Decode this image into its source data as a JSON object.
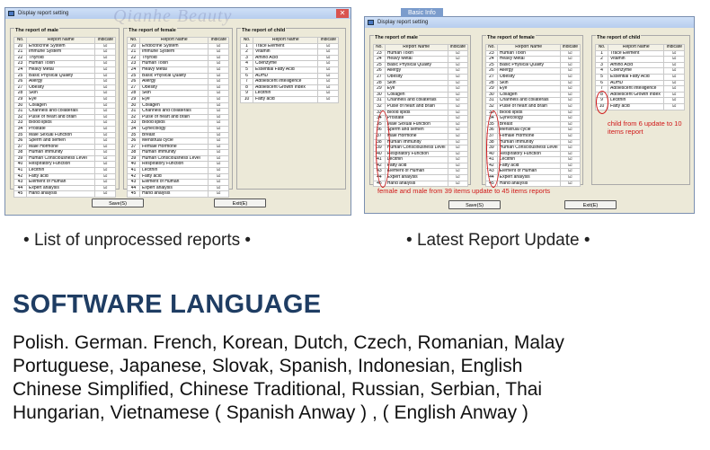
{
  "left_window": {
    "title": "Display report setting",
    "watermark": "Qianhe Beauty",
    "male": {
      "title": "The report of male",
      "head": [
        "No.",
        "Report Name",
        "Indicate"
      ],
      "rows": [
        [
          "20",
          "Endocrine System"
        ],
        [
          "21",
          "Immune System"
        ],
        [
          "22",
          "Thyroid"
        ],
        [
          "23",
          "Human Toxin"
        ],
        [
          "24",
          "Heavy Metal"
        ],
        [
          "25",
          "Basic Physical Quality"
        ],
        [
          "26",
          "Allergy"
        ],
        [
          "27",
          "Obesity"
        ],
        [
          "28",
          "Skin"
        ],
        [
          "29",
          "Eye"
        ],
        [
          "30",
          "Collagen"
        ],
        [
          "31",
          "Channels and collaterals"
        ],
        [
          "32",
          "Pulse of heart and brain"
        ],
        [
          "33",
          "Blood lipids"
        ],
        [
          "34",
          "Prostate"
        ],
        [
          "35",
          "Male Sexual Function"
        ],
        [
          "36",
          "Sperm and semen"
        ],
        [
          "37",
          "Male Hormone"
        ],
        [
          "38",
          "Human Immunity"
        ],
        [
          "39",
          "Human Consciousness Level"
        ],
        [
          "40",
          "Respiratory Function"
        ],
        [
          "41",
          "Lecithin"
        ],
        [
          "42",
          "Fatty acid"
        ],
        [
          "43",
          "Element of Human"
        ],
        [
          "44",
          "Expert analysis"
        ],
        [
          "45",
          "Hand analysis"
        ]
      ]
    },
    "female": {
      "title": "The report of female",
      "head": [
        "No.",
        "Report Name",
        "Indicate"
      ],
      "rows": [
        [
          "20",
          "Endocrine System"
        ],
        [
          "21",
          "Immune System"
        ],
        [
          "22",
          "Thyroid"
        ],
        [
          "23",
          "Human Toxin"
        ],
        [
          "24",
          "Heavy Metal"
        ],
        [
          "25",
          "Basic Physical Quality"
        ],
        [
          "26",
          "Allergy"
        ],
        [
          "27",
          "Obesity"
        ],
        [
          "28",
          "Skin"
        ],
        [
          "29",
          "Eye"
        ],
        [
          "30",
          "Collagen"
        ],
        [
          "31",
          "Channels and collaterals"
        ],
        [
          "32",
          "Pulse of heart and brain"
        ],
        [
          "33",
          "Blood lipids"
        ],
        [
          "34",
          "Gynecology"
        ],
        [
          "35",
          "Breast"
        ],
        [
          "36",
          "Menstrual cycle"
        ],
        [
          "37",
          "Female Hormone"
        ],
        [
          "38",
          "Human Immunity"
        ],
        [
          "39",
          "Human Consciousness Level"
        ],
        [
          "40",
          "Respiratory Function"
        ],
        [
          "41",
          "Lecithin"
        ],
        [
          "42",
          "Fatty acid"
        ],
        [
          "43",
          "Element of Human"
        ],
        [
          "44",
          "Expert analysis"
        ],
        [
          "45",
          "Hand analysis"
        ]
      ]
    },
    "child": {
      "title": "The report of child",
      "head": [
        "No.",
        "Report Name",
        "Indicate"
      ],
      "rows": [
        [
          "1",
          "Trace Element"
        ],
        [
          "2",
          "Vitamin"
        ],
        [
          "3",
          "Amino Acid"
        ],
        [
          "4",
          "Coenzyme"
        ],
        [
          "5",
          "Essential Fatty Acid"
        ],
        [
          "6",
          "ADHD"
        ],
        [
          "7",
          "Adolescent Intelligence"
        ],
        [
          "8",
          "Adolescent Growth Index"
        ],
        [
          "9",
          "Lecithin"
        ],
        [
          "10",
          "Fatty acid"
        ]
      ]
    },
    "save_label": "Save(S)",
    "exit_label": "Exit(E)"
  },
  "right_window": {
    "title": "Display report setting",
    "tab_label": "Basic Info",
    "male": {
      "title": "The report of male",
      "head": [
        "No.",
        "Report Name",
        "Indicate"
      ],
      "rows": [
        [
          "23",
          "Human Toxin"
        ],
        [
          "24",
          "Heavy Metal"
        ],
        [
          "25",
          "Basic Physical Quality"
        ],
        [
          "26",
          "Allergy"
        ],
        [
          "27",
          "Obesity"
        ],
        [
          "28",
          "Skin"
        ],
        [
          "29",
          "Eye"
        ],
        [
          "30",
          "Collagen"
        ],
        [
          "31",
          "Channels and collaterals"
        ],
        [
          "32",
          "Pulse of heart and brain"
        ],
        [
          "33",
          "Blood lipids"
        ],
        [
          "34",
          "Prostate"
        ],
        [
          "35",
          "Male Sexual Function"
        ],
        [
          "36",
          "Sperm and semen"
        ],
        [
          "37",
          "Male Hormone"
        ],
        [
          "38",
          "Human Immunity"
        ],
        [
          "39",
          "Human Consciousness Level"
        ],
        [
          "40",
          "Respiratory Function"
        ],
        [
          "41",
          "Lecithin"
        ],
        [
          "42",
          "Fatty acid"
        ],
        [
          "43",
          "Element of Human"
        ],
        [
          "44",
          "Expert analysis"
        ],
        [
          "45",
          "Hand analysis"
        ]
      ]
    },
    "female": {
      "title": "The report of female",
      "head": [
        "No.",
        "Report Name",
        "Indicate"
      ],
      "rows": [
        [
          "23",
          "Human Toxin"
        ],
        [
          "24",
          "Heavy Metal"
        ],
        [
          "25",
          "Basic Physical Quality"
        ],
        [
          "26",
          "Allergy"
        ],
        [
          "27",
          "Obesity"
        ],
        [
          "28",
          "Skin"
        ],
        [
          "29",
          "Eye"
        ],
        [
          "30",
          "Collagen"
        ],
        [
          "31",
          "Channels and collaterals"
        ],
        [
          "32",
          "Pulse of heart and brain"
        ],
        [
          "33",
          "Blood lipids"
        ],
        [
          "34",
          "Gynecology"
        ],
        [
          "35",
          "Breast"
        ],
        [
          "36",
          "Menstrual cycle"
        ],
        [
          "37",
          "Female Hormone"
        ],
        [
          "38",
          "Human Immunity"
        ],
        [
          "39",
          "Human Consciousness Level"
        ],
        [
          "40",
          "Respiratory Function"
        ],
        [
          "41",
          "Lecithin"
        ],
        [
          "42",
          "Fatty acid"
        ],
        [
          "43",
          "Element of Human"
        ],
        [
          "44",
          "Expert analysis"
        ],
        [
          "45",
          "Hand analysis"
        ]
      ]
    },
    "child": {
      "title": "The report of child",
      "head": [
        "No.",
        "Report Name",
        "Indicate"
      ],
      "rows": [
        [
          "1",
          "Trace Element"
        ],
        [
          "2",
          "Vitamin"
        ],
        [
          "3",
          "Amino Acid"
        ],
        [
          "4",
          "Coenzyme"
        ],
        [
          "5",
          "Essential Fatty Acid"
        ],
        [
          "6",
          "ADHD"
        ],
        [
          "7",
          "Adolescent Intelligence"
        ],
        [
          "8",
          "Adolescent Growth Index"
        ],
        [
          "9",
          "Lecithin"
        ],
        [
          "10",
          "Fatty acid"
        ]
      ]
    },
    "child_note": "child from 6 update to 10 items report",
    "adult_note": "female and male from 39 items update to 45 items reports",
    "save_label": "Save(S)",
    "exit_label": "Exit(E)"
  },
  "captions": {
    "left": "List of unprocessed reports",
    "right": "Latest Report Update"
  },
  "heading": "SOFTWARE LANGUAGE",
  "languages": [
    "Polish. German. French, Korean, Dutch, Czech, Romanian, Malay",
    "Portuguese, Japanese, Slovak, Spanish, Indonesian, English",
    "Chinese Simplified, Chinese Traditional, Russian, Serbian, Thai",
    "Hungarian, Vietnamese ( Spanish Anway ) , ( English Anway )"
  ],
  "check_glyph": "☑",
  "colors": {
    "heading": "#1f3d63",
    "annotation": "#d01818",
    "window_bg": "#ece9d8"
  }
}
